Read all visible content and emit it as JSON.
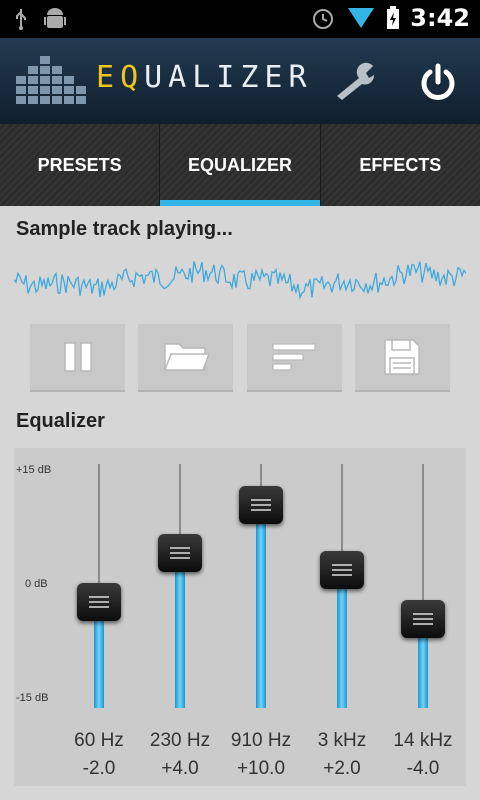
{
  "status_bar": {
    "time": "3:42"
  },
  "app": {
    "title_first": "E",
    "title_second": "Q",
    "title_rest": "UALIZER"
  },
  "tabs": [
    {
      "label": "PRESETS",
      "active": false
    },
    {
      "label": "EQUALIZER",
      "active": true
    },
    {
      "label": "EFFECTS",
      "active": false
    }
  ],
  "player": {
    "track_status": "Sample track playing..."
  },
  "equalizer": {
    "heading": "Equalizer",
    "scale": {
      "top": "+15 dB",
      "mid": "0 dB",
      "bottom": "-15 dB",
      "max_db": 15,
      "min_db": -15
    },
    "bands": [
      {
        "freq": "60 Hz",
        "gain_label": "-2.0",
        "gain": -2.0
      },
      {
        "freq": "230 Hz",
        "gain_label": "+4.0",
        "gain": 4.0
      },
      {
        "freq": "910 Hz",
        "gain_label": "+10.0",
        "gain": 10.0
      },
      {
        "freq": "3 kHz",
        "gain_label": "+2.0",
        "gain": 2.0
      },
      {
        "freq": "14 kHz",
        "gain_label": "-4.0",
        "gain": -4.0
      }
    ]
  },
  "colors": {
    "accent": "#33b5e5",
    "waveform": "#3fa9dd",
    "knob": "#111111"
  }
}
